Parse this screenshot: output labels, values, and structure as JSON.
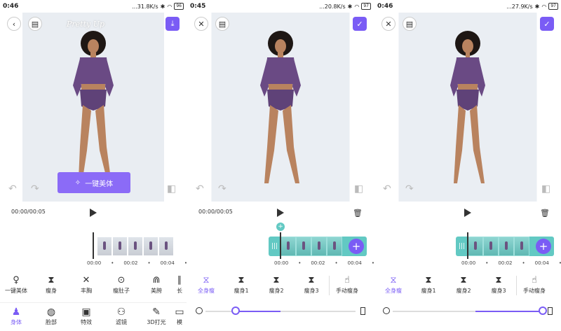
{
  "panels": [
    {
      "status": {
        "time": "0:46",
        "speed": "...31.8K/s",
        "battery": "96"
      },
      "watermark": "Pretty Up",
      "one_click_label": "一键美体",
      "timecode": "00:00/00:05",
      "ticks": [
        "00:00",
        "00:02",
        "00:04"
      ],
      "tools": [
        {
          "label": "一键美体",
          "icon": "body-magic-icon"
        },
        {
          "label": "瘦身",
          "icon": "slim-icon"
        },
        {
          "label": "丰胸",
          "icon": "chest-icon"
        },
        {
          "label": "瘦肚子",
          "icon": "belly-icon"
        },
        {
          "label": "美胯",
          "icon": "hip-icon"
        },
        {
          "label": "长",
          "icon": "leg-icon"
        }
      ],
      "bottom": [
        {
          "label": "身体",
          "icon": "body-icon",
          "active": true
        },
        {
          "label": "脸部",
          "icon": "face-icon"
        },
        {
          "label": "特效",
          "icon": "effects-icon"
        },
        {
          "label": "滤镜",
          "icon": "filter-icon"
        },
        {
          "label": "3D打光",
          "icon": "light-icon"
        },
        {
          "label": "模",
          "icon": "template-icon"
        }
      ]
    },
    {
      "status": {
        "time": "0:45",
        "speed": "...20.8K/s",
        "battery": "97"
      },
      "timecode": "00:00/00:05",
      "ticks": [
        "00:00",
        "00:02",
        "00:04"
      ],
      "tools": [
        {
          "label": "全身瘦",
          "icon": "full-body-icon",
          "active": true
        },
        {
          "label": "瘦身1",
          "icon": "slim1-icon"
        },
        {
          "label": "瘦身2",
          "icon": "slim2-icon"
        },
        {
          "label": "瘦身3",
          "icon": "slim3-icon"
        },
        {
          "label": "手动瘦身",
          "icon": "manual-slim-icon"
        }
      ],
      "slider": 0.2
    },
    {
      "status": {
        "time": "0:46",
        "speed": "...27.9K/s",
        "battery": "97"
      },
      "timecode": "",
      "ticks": [
        "00:00",
        "00:02",
        "00:04"
      ],
      "tools": [
        {
          "label": "全身瘦",
          "icon": "full-body-icon",
          "active": true
        },
        {
          "label": "瘦身1",
          "icon": "slim1-icon"
        },
        {
          "label": "瘦身2",
          "icon": "slim2-icon"
        },
        {
          "label": "瘦身3",
          "icon": "slim3-icon"
        },
        {
          "label": "手动瘦身",
          "icon": "manual-slim-icon"
        }
      ],
      "slider": 1.0
    }
  ],
  "colors": {
    "accent": "#7a5cf5",
    "teal": "#62c9c3"
  }
}
